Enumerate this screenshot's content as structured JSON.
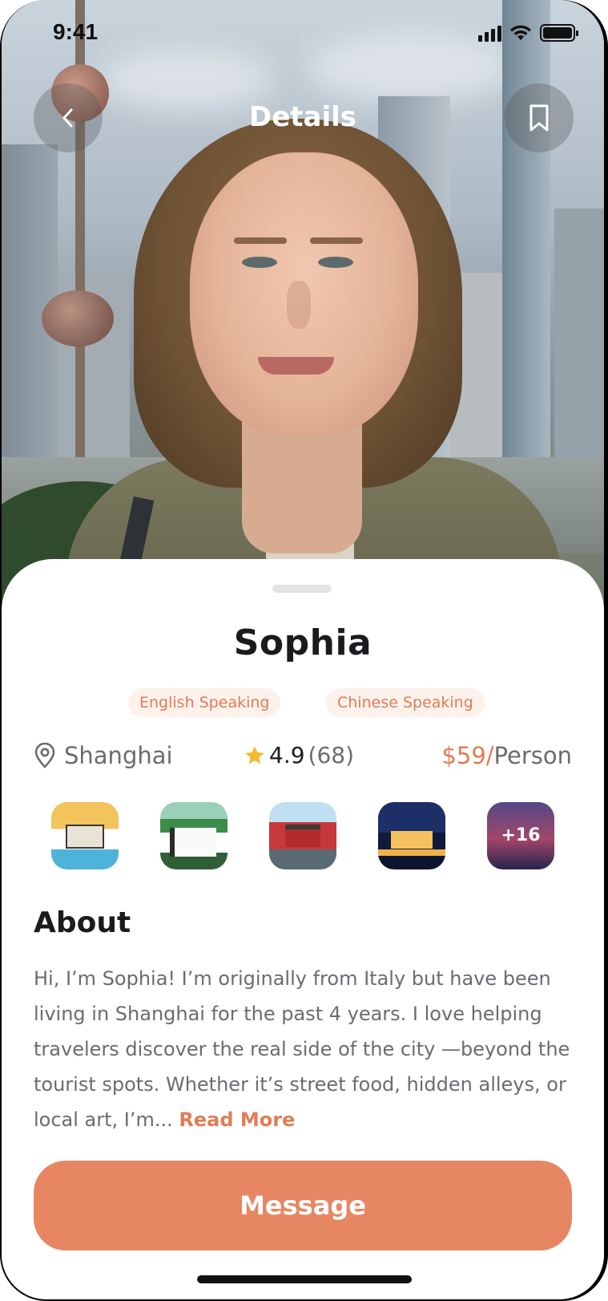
{
  "status_bar": {
    "time": "9:41"
  },
  "header": {
    "title": "Details"
  },
  "profile": {
    "name": "Sophia",
    "languages": [
      "English Speaking",
      "Chinese Speaking"
    ],
    "location": "Shanghai",
    "rating": "4.9",
    "rating_count": "(68)",
    "price": "$59/",
    "price_unit": "Person",
    "gallery_more": "+16"
  },
  "about": {
    "title": "About",
    "text": "Hi, I’m Sophia! I’m originally from Italy but have been living in Shanghai for the past 4 years. I love helping travelers discover the real side of the city —beyond the tourist spots. Whether it’s street food, hidden alleys, or local art, I’m... ",
    "read_more": "Read More"
  },
  "actions": {
    "message": "Message"
  },
  "colors": {
    "accent": "#E78662",
    "chip_bg": "#FDF1EC",
    "chip_text": "#E27C55",
    "star": "#F5B82E"
  }
}
